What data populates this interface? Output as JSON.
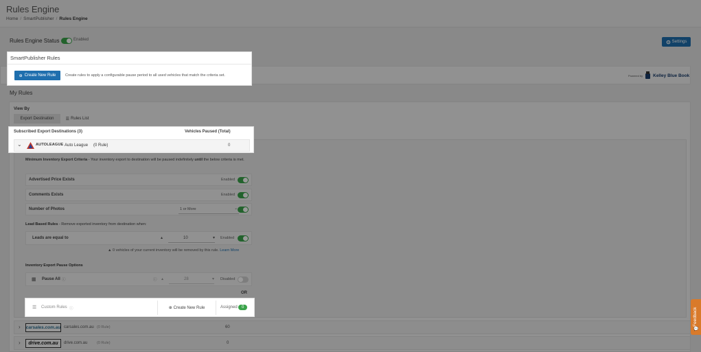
{
  "header": {
    "title": "Rules Engine",
    "breadcrumbs": [
      "Home",
      "SmartPublisher",
      "Rules Engine"
    ]
  },
  "status": {
    "label": "Rules Engine Status",
    "state": "Enabled"
  },
  "settings_button": {
    "label": "Settings",
    "icon": "gear-icon"
  },
  "smartpublisher": {
    "title": "SmartPublisher Rules",
    "create_label": "Create New Rule",
    "description": "Create rules to apply a configurable pause period to all used vehicles that match the criteria set."
  },
  "powered_by": {
    "prefix": "Powered by",
    "brand": "Kelley Blue Book"
  },
  "my_rules": {
    "title": "My Rules",
    "view_by": "View By",
    "tabs": [
      "Export Destination",
      "Rules List"
    ]
  },
  "destinations": {
    "header_left": "Subscribed Export Destinations (3)",
    "header_right": "Vehicles Paused (Total)",
    "primary": {
      "logo_text": "AUTOLEAGUE",
      "name": "Auto League",
      "rules": "(0 Rule)",
      "paused": "0"
    }
  },
  "minimum_criteria": {
    "title": "Minimum Inventory Export Criteria",
    "text_pre": " - Your inventory export to destination will be paused indefinitely ",
    "text_until": "until",
    "text_post": " the below criteria is met.",
    "rows": [
      {
        "label": "Advertised Price Exists",
        "state": "Enabled"
      },
      {
        "label": "Comments Exists",
        "state": "Enabled"
      },
      {
        "label": "Number of Photos",
        "select": "1 or More"
      }
    ]
  },
  "lead_rules": {
    "title": "Lead Based Rules",
    "subtitle": " - Remove exported inventory from destination when:",
    "label": "Leads are equal to",
    "value": "10",
    "state": "Enabled",
    "warning_text": "0 vehicles of your current inventory will be removed by this rule.",
    "learn_more": "Learn More"
  },
  "pause_options": {
    "title": "Inventory Export Pause Options",
    "label": "Pause All",
    "value": "28",
    "state": "Disabled",
    "or_label": "OR"
  },
  "custom_rules": {
    "label": "Custom Rules",
    "create_label": "Create New Rule",
    "assigned_label": "Assigned",
    "assigned_count": "0"
  },
  "other_destinations": [
    {
      "logo": "carsales.com.au",
      "name": "carsales.com.au",
      "rules": "(0 Rule)",
      "paused": "60"
    },
    {
      "logo": "drive.com.au",
      "name": "drive.com.au",
      "rules": "(0 Rule)",
      "paused": "0"
    }
  ],
  "feedback": {
    "label": "Feedback"
  },
  "colors": {
    "primary": "#1f6fae",
    "success": "#3aa34a",
    "feedback": "#d97a2a"
  }
}
